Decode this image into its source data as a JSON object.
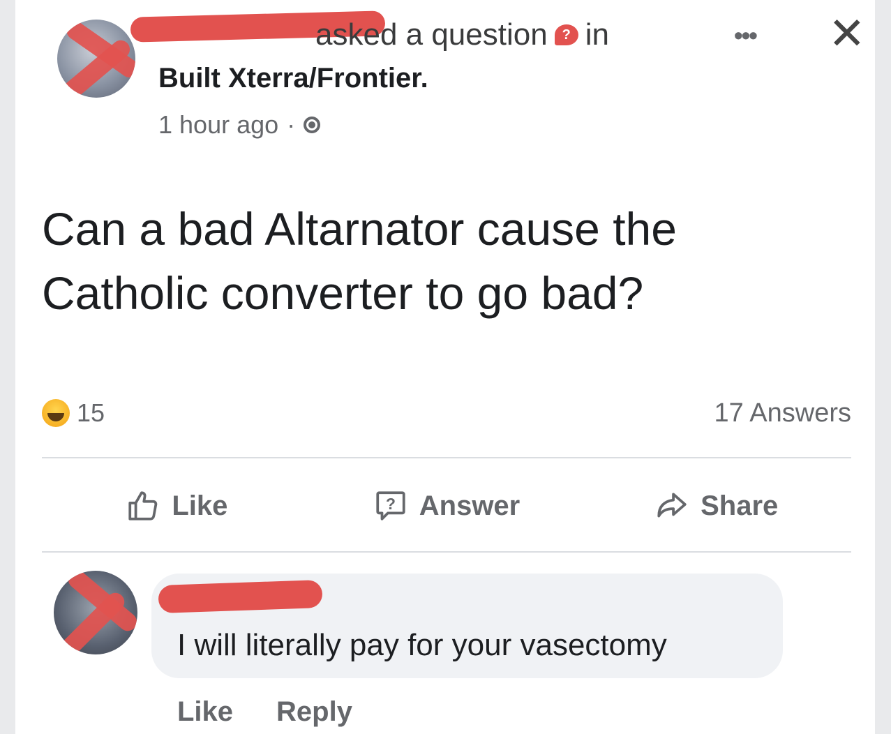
{
  "post": {
    "asked_text": "asked a question",
    "in_text": "in",
    "group_name": "Built Xterra/Frontier.",
    "timestamp": "1 hour ago",
    "separator": "·",
    "question": "Can a bad Altarnator cause the Catholic converter to go bad?",
    "reaction_count": "15",
    "reaction_icon": "haha-emoji-icon",
    "answers_count": "17 Answers"
  },
  "actions": {
    "like": "Like",
    "answer": "Answer",
    "share": "Share"
  },
  "comment": {
    "text": "I will literally pay for your vasectomy",
    "like": "Like",
    "reply": "Reply"
  },
  "colors": {
    "redaction": "#e2524f",
    "secondary_text": "#65676b",
    "bubble": "#f0f2f5"
  }
}
